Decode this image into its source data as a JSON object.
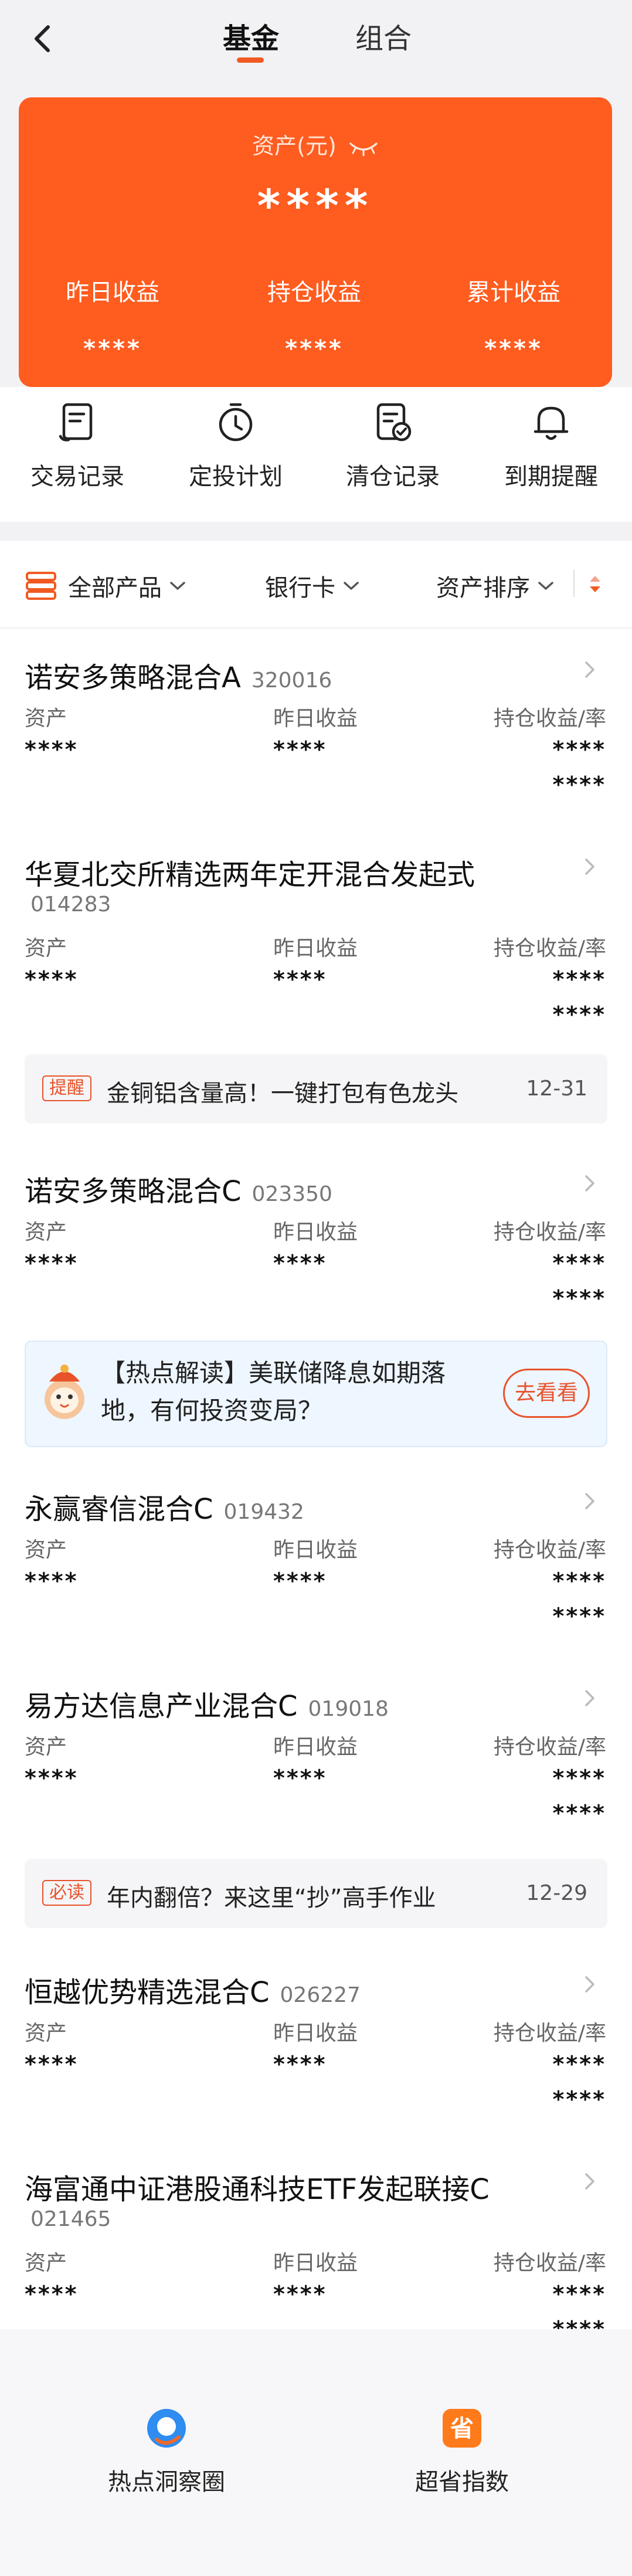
{
  "header": {
    "back_icon": "chevron-left-icon",
    "tabs": [
      {
        "label": "基金",
        "active": true
      },
      {
        "label": "组合",
        "active": false
      }
    ],
    "accent_color": "#f05a22"
  },
  "asset_card": {
    "title": "资产(元)",
    "eye_icon": "eye-closed-icon",
    "total": "****",
    "metrics": [
      {
        "label": "昨日收益",
        "value": "****"
      },
      {
        "label": "持仓收益",
        "value": "****"
      },
      {
        "label": "累计收益",
        "value": "****"
      }
    ],
    "background_color": "#ff5c1f"
  },
  "quick_actions": [
    {
      "label": "交易记录",
      "icon": "document-list-icon"
    },
    {
      "label": "定投计划",
      "icon": "timer-icon"
    },
    {
      "label": "清仓记录",
      "icon": "document-check-icon"
    },
    {
      "label": "到期提醒",
      "icon": "bell-icon"
    }
  ],
  "filters": [
    {
      "label": "全部产品",
      "icon": "stack-icon"
    },
    {
      "label": "银行卡"
    },
    {
      "label": "资产排序"
    }
  ],
  "columns": {
    "asset": "资产",
    "yesterday": "昨日收益",
    "holding": "持仓收益/率"
  },
  "funds": [
    {
      "name": "诺安多策略混合A",
      "code": "320016",
      "asset": "****",
      "yesterday": "****",
      "holding": "****",
      "rate": "****"
    },
    {
      "name": "华夏北交所精选两年定开混合发起式",
      "code": "014283",
      "asset": "****",
      "yesterday": "****",
      "holding": "****",
      "rate": "****"
    },
    {
      "name": "诺安多策略混合C",
      "code": "023350",
      "asset": "****",
      "yesterday": "****",
      "holding": "****",
      "rate": "****"
    },
    {
      "name": "永赢睿信混合C",
      "code": "019432",
      "asset": "****",
      "yesterday": "****",
      "holding": "****",
      "rate": "****"
    },
    {
      "name": "易方达信息产业混合C",
      "code": "019018",
      "asset": "****",
      "yesterday": "****",
      "holding": "****",
      "rate": "****"
    },
    {
      "name": "恒越优势精选混合C",
      "code": "026227",
      "asset": "****",
      "yesterday": "****",
      "holding": "****",
      "rate": "****"
    },
    {
      "name": "海富通中证港股通科技ETF发起联接C",
      "code": "021465",
      "asset": "****",
      "yesterday": "****",
      "holding": "****",
      "rate": "****"
    }
  ],
  "notices": [
    {
      "tag": "提醒",
      "text": "金铜铝含量高！一键打包有色龙头",
      "date": "12-31"
    },
    {
      "tag": "必读",
      "text": "年内翻倍？来这里“抄”高手作业",
      "date": "12-29"
    }
  ],
  "hot_card": {
    "line1": "【热点解读】美联储降息如期落",
    "line2": "地，有何投资变局？",
    "button": "去看看",
    "icon": "mascot-icon"
  },
  "bottom_bar": [
    {
      "label": "热点洞察圈",
      "icon": "insight-circle-icon"
    },
    {
      "label": "超省指数",
      "icon": "save-index-icon",
      "glyph": "省"
    }
  ]
}
